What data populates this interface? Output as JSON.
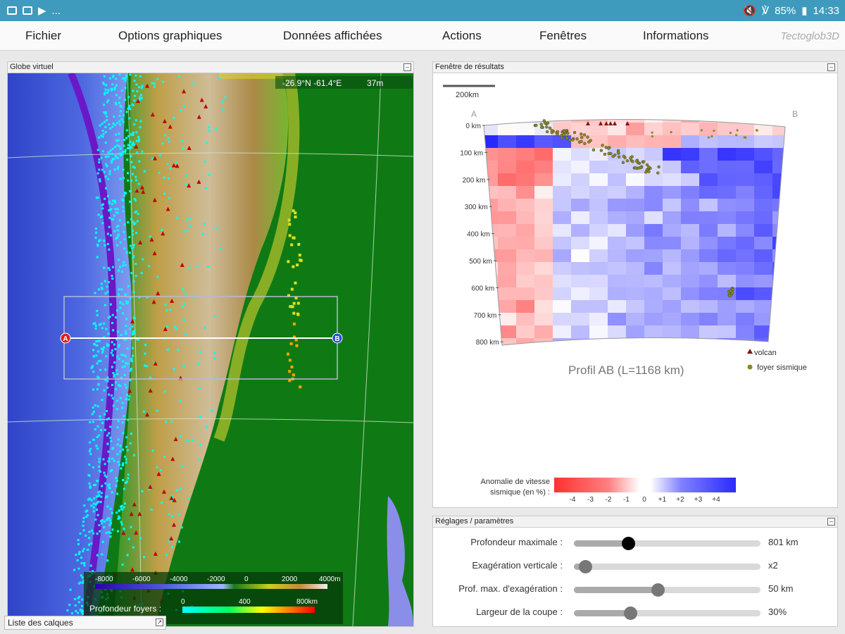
{
  "statusbar": {
    "battery": "85%",
    "time": "14:33",
    "dots": "..."
  },
  "menu": {
    "items": [
      "Fichier",
      "Options graphiques",
      "Données affichées",
      "Actions",
      "Fenêtres",
      "Informations"
    ],
    "brand": "Tectoglob3D"
  },
  "globe": {
    "title": "Globe virtuel",
    "coords": "-26.9°N  -61.4°E",
    "zoom": "37m",
    "point_a": "A",
    "point_b": "B",
    "elevation_ticks": [
      "-8000",
      "-6000",
      "-4000",
      "-2000",
      "0",
      "2000",
      "4000m"
    ],
    "depth_label": "Profondeur foyers :",
    "depth_ticks": [
      "0",
      "400",
      "800km"
    ]
  },
  "layers_panel": {
    "title": "Liste des calques"
  },
  "results": {
    "title": "Fenêtre de résultats",
    "scale_label": "200km",
    "point_a": "A",
    "point_b": "B",
    "depth_ticks": [
      "0 km",
      "100 km",
      "200 km",
      "300 km",
      "400 km",
      "500 km",
      "600 km",
      "700 km",
      "800 km"
    ],
    "profile_title": "Profil AB (L=1168 km)",
    "legend": {
      "volcano": "volcan",
      "quake": "foyer sismique"
    },
    "colorbar": {
      "label_line1": "Anomalie de vitesse",
      "label_line2": "sismique (en %) :",
      "ticks": [
        "-4",
        "-3",
        "-2",
        "-1",
        "0",
        "+1",
        "+2",
        "+3",
        "+4"
      ]
    }
  },
  "settings": {
    "title": "Réglages / paramètres",
    "sliders": [
      {
        "label": "Profondeur maximale :",
        "value": "801 km",
        "fraction": 0.29
      },
      {
        "label": "Exagération verticale :",
        "value": "x2",
        "fraction": 0.06
      },
      {
        "label": "Prof. max. d'exagération :",
        "value": "50 km",
        "fraction": 0.45
      },
      {
        "label": "Largeur de la coupe :",
        "value": "30%",
        "fraction": 0.3
      }
    ]
  },
  "colors": {
    "statusbar": "#3e9bbd",
    "anomaly_neg": "#ff3030",
    "anomaly_pos": "#2a2aff",
    "quake": "#00ffff",
    "volcano": "#c00000"
  }
}
